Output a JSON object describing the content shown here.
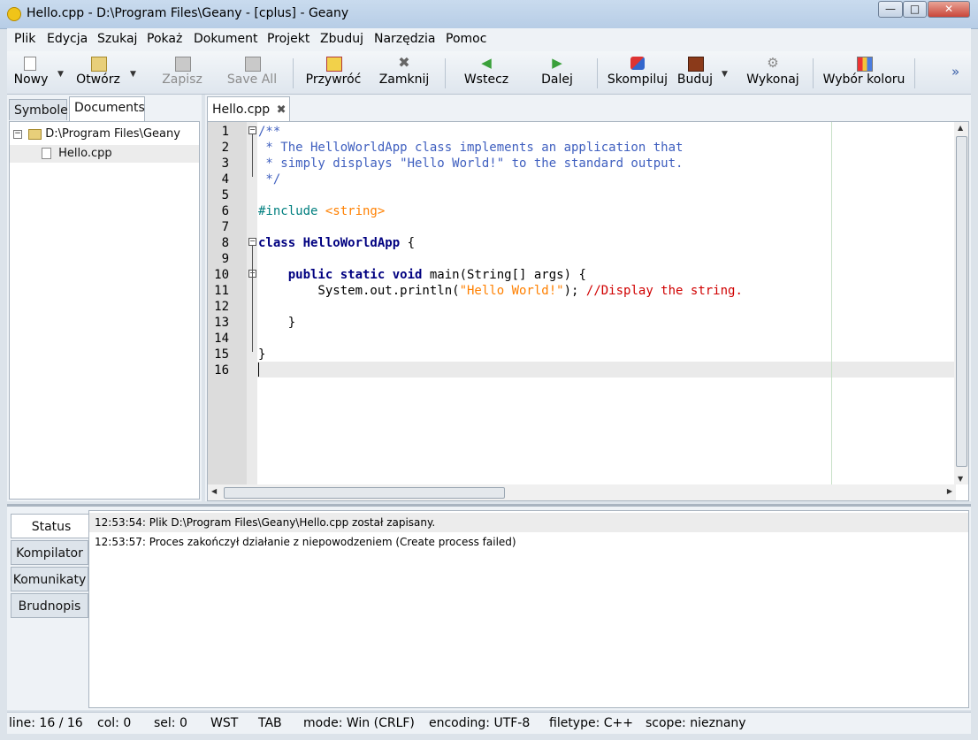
{
  "window": {
    "title": "Hello.cpp - D:\\Program Files\\Geany - [cplus] - Geany",
    "controls": {
      "minimize": "—",
      "maximize": "□",
      "close": "✕"
    }
  },
  "menu": [
    "Plik",
    "Edycja",
    "Szukaj",
    "Pokaż",
    "Dokument",
    "Projekt",
    "Zbuduj",
    "Narzędzia",
    "Pomoc"
  ],
  "toolbar": {
    "new": "Nowy",
    "open": "Otwórz",
    "save": "Zapisz",
    "save_all": "Save All",
    "revert": "Przywróć",
    "close": "Zamknij",
    "back": "Wstecz",
    "forward": "Dalej",
    "compile": "Skompiluj",
    "build": "Buduj",
    "execute": "Wykonaj",
    "color": "Wybór koloru",
    "overflow": "»"
  },
  "sidebar": {
    "tabs": [
      "Symbole",
      "Documents"
    ],
    "active_tab": "Documents",
    "folder": "D:\\Program Files\\Geany",
    "files": [
      "Hello.cpp"
    ]
  },
  "editor": {
    "tab_label": "Hello.cpp",
    "tab_close": "✖",
    "line_numbers": [
      "1",
      "2",
      "3",
      "4",
      "5",
      "6",
      "7",
      "8",
      "9",
      "10",
      "11",
      "12",
      "13",
      "14",
      "15",
      "16"
    ],
    "lines": [
      [
        {
          "t": "/**",
          "c": "cm"
        }
      ],
      [
        {
          "t": " * The HelloWorldApp class implements an application that",
          "c": "cm"
        }
      ],
      [
        {
          "t": " * simply displays \"Hello World!\" to the standard output.",
          "c": "cm"
        }
      ],
      [
        {
          "t": " */",
          "c": "cm"
        }
      ],
      [],
      [
        {
          "t": "#include ",
          "c": "pp"
        },
        {
          "t": "<string>",
          "c": "str"
        }
      ],
      [],
      [
        {
          "t": "class ",
          "c": "kw"
        },
        {
          "t": "HelloWorldApp",
          "c": "kw"
        },
        {
          "t": " {",
          "c": "pl"
        }
      ],
      [],
      [
        {
          "t": "    public static void ",
          "c": "kw"
        },
        {
          "t": "main(String[] args) {",
          "c": "pl"
        }
      ],
      [
        {
          "t": "        System.out.println(",
          "c": "pl"
        },
        {
          "t": "\"Hello World!\"",
          "c": "str"
        },
        {
          "t": "); ",
          "c": "pl"
        },
        {
          "t": "//Display the string.",
          "c": "lc"
        }
      ],
      [],
      [
        {
          "t": "    }",
          "c": "pl"
        }
      ],
      [],
      [
        {
          "t": "}",
          "c": "pl"
        }
      ],
      []
    ],
    "current_line": 16
  },
  "bottom_panel": {
    "tabs": [
      "Status",
      "Kompilator",
      "Komunikaty",
      "Brudnopis"
    ],
    "active_tab": "Status",
    "messages": [
      "12:53:54: Plik D:\\Program Files\\Geany\\Hello.cpp został zapisany.",
      "12:53:57: Proces zakończył działanie z niepowodzeniem (Create process failed)"
    ]
  },
  "statusbar": {
    "line": "line: 16 / 16",
    "col": "col: 0",
    "sel": "sel: 0",
    "ins": "WST",
    "indent": "TAB",
    "mode": "mode: Win (CRLF)",
    "encoding": "encoding: UTF-8",
    "filetype": "filetype: C++",
    "scope": "scope: nieznany"
  }
}
